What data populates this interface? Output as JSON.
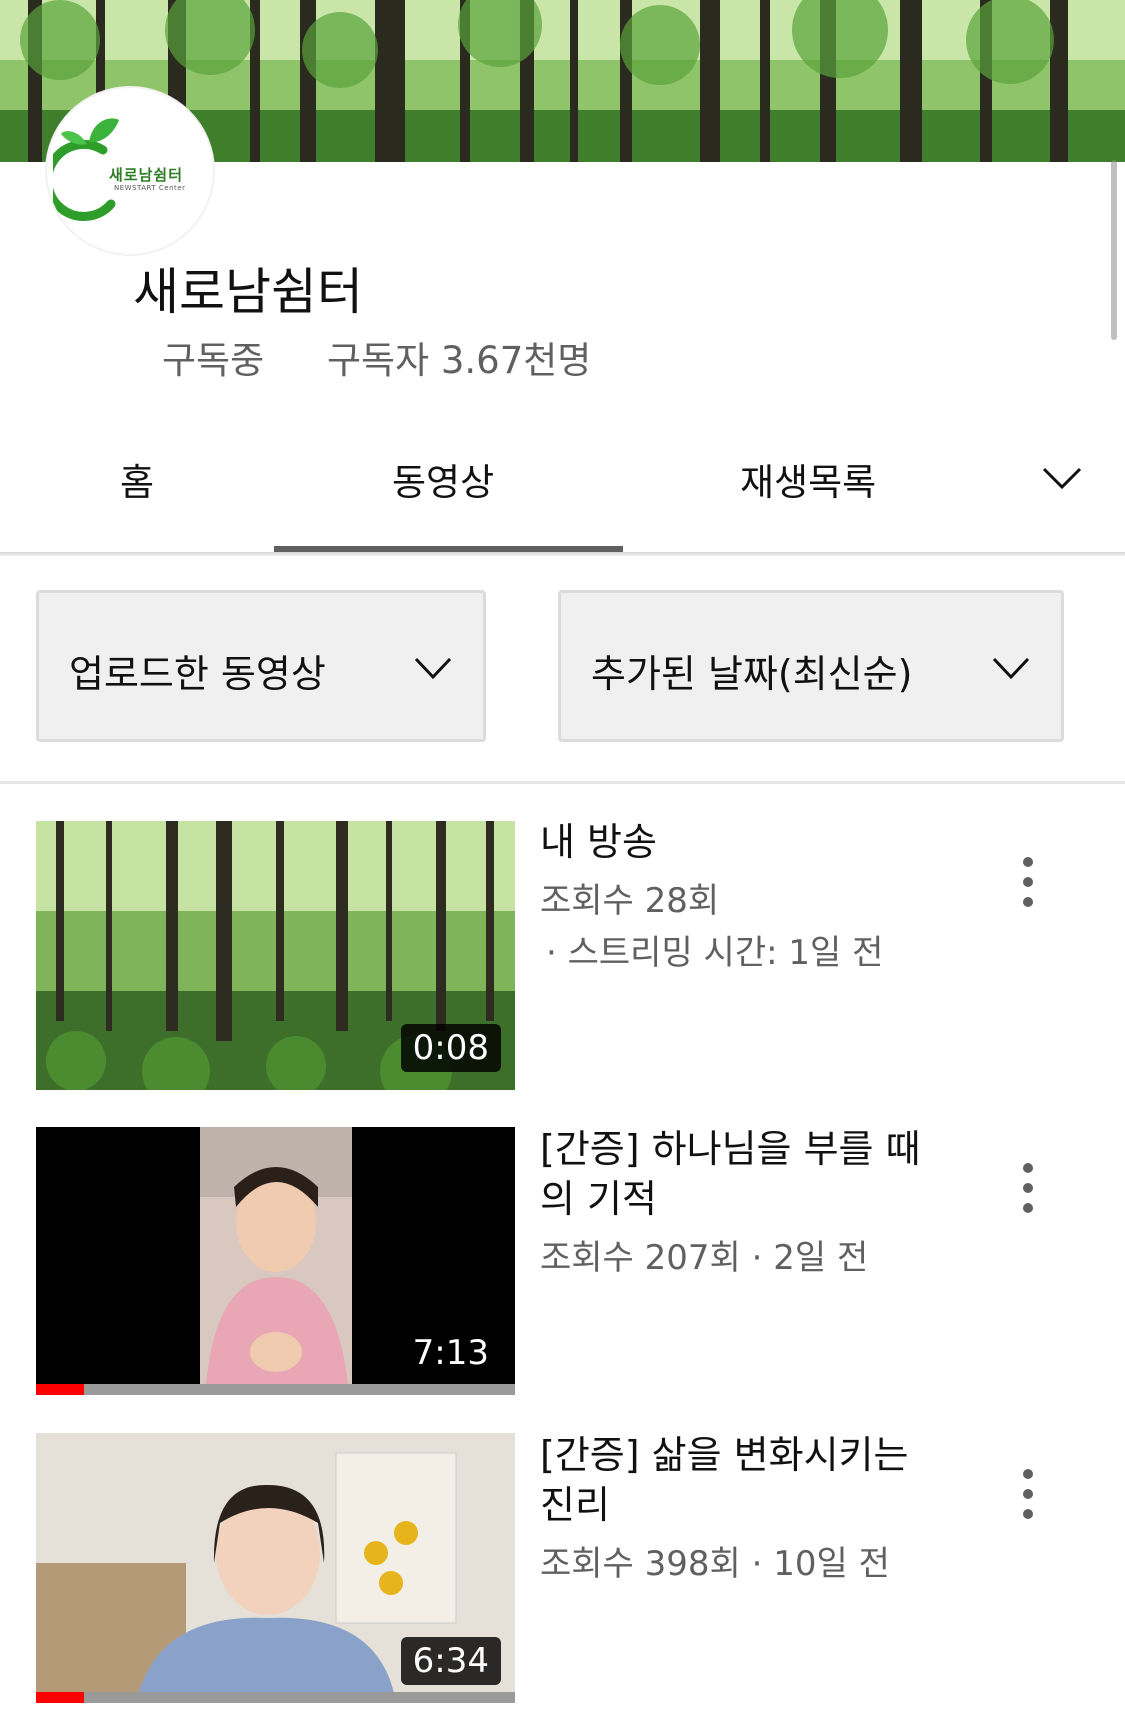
{
  "channel": {
    "name": "새로남쉼터",
    "subscribed_label": "구독중",
    "subscriber_count": "구독자 3.67천명",
    "logo_text": "새로남쉼터",
    "logo_subtext": "NEWSTART Center"
  },
  "tabs": [
    {
      "label": "홈",
      "active": false
    },
    {
      "label": "동영상",
      "active": true
    },
    {
      "label": "재생목록",
      "active": false
    }
  ],
  "filters": {
    "uploads_label": "업로드한 동영상",
    "sort_label": "추가된 날짜(최신순)"
  },
  "videos": [
    {
      "title": "내 방송",
      "views": "조회수 28회",
      "streamed": "· 스트리밍 시간: 1일 전",
      "duration": "0:08",
      "progress": 0
    },
    {
      "title": "[간증] 하나님을 부를 때의 기적",
      "meta": "조회수 207회 · 2일 전",
      "duration": "7:13",
      "progress": 0.1
    },
    {
      "title": "[간증] 삶을 변화시키는 진리",
      "meta": "조회수 398회 · 10일 전",
      "duration": "6:34",
      "progress": 0.1
    }
  ],
  "colors": {
    "progress": "#ff0000",
    "logo_green": "#2e7d25",
    "text_secondary": "#606060"
  }
}
